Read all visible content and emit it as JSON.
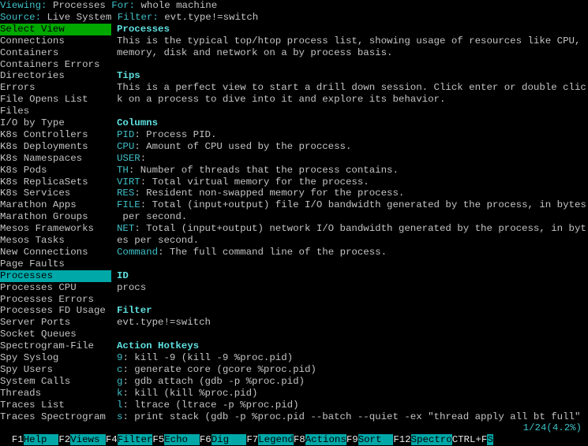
{
  "header": {
    "viewing_label": "Viewing:",
    "viewing_value": "Processes",
    "for_label": "For:",
    "for_value": "whole machine",
    "source_label": "Source:",
    "source_value": "Live System",
    "filter_label": "Filter:",
    "filter_value": "evt.type!=switch"
  },
  "views": {
    "title": "Select View",
    "items": [
      "Connections",
      "Containers",
      "Containers Errors",
      "Directories",
      "Errors",
      "File Opens List",
      "Files",
      "I/O by Type",
      "K8s Controllers",
      "K8s Deployments",
      "K8s Namespaces",
      "K8s Pods",
      "K8s ReplicaSets",
      "K8s Services",
      "Marathon Apps",
      "Marathon Groups",
      "Mesos Frameworks",
      "Mesos Tasks",
      "New Connections",
      "Page Faults",
      "Processes",
      "Processes CPU",
      "Processes Errors",
      "Processes FD Usage",
      "Server Ports",
      "Socket Queues",
      "Spectrogram-File",
      "Spy Syslog",
      "Spy Users",
      "System Calls",
      "Threads",
      "Traces List",
      "Traces Spectrogram"
    ],
    "selected": "Processes"
  },
  "info": [
    {
      "heading": "Processes"
    },
    {
      "text": "This is the typical top/htop process list, showing usage of resources like CPU,"
    },
    {
      "text": "memory, disk and network on a by process basis."
    },
    {
      "text": ""
    },
    {
      "heading": "Tips"
    },
    {
      "text": "This is a perfect view to start a drill down session. Click enter or double clic"
    },
    {
      "text": "k on a process to dive into it and explore its behavior."
    },
    {
      "text": ""
    },
    {
      "heading": "Columns"
    },
    {
      "key": "PID",
      "text": ": Process PID."
    },
    {
      "key": "CPU",
      "text": ": Amount of CPU used by the proccess."
    },
    {
      "key": "USER",
      "text": ":"
    },
    {
      "key": "TH",
      "text": ": Number of threads that the process contains."
    },
    {
      "key": "VIRT",
      "text": ": Total virtual memory for the process."
    },
    {
      "key": "RES",
      "text": ": Resident non-swapped memory for the process."
    },
    {
      "key": "FILE",
      "text": ": Total (input+output) file I/O bandwidth generated by the process, in bytes"
    },
    {
      "text": " per second."
    },
    {
      "key": "NET",
      "text": ": Total (input+output) network I/O bandwidth generated by the process, in byt"
    },
    {
      "text": "es per second."
    },
    {
      "key": "Command",
      "text": ": The full command line of the process."
    },
    {
      "text": ""
    },
    {
      "heading": "ID"
    },
    {
      "text": "procs"
    },
    {
      "text": ""
    },
    {
      "heading": "Filter"
    },
    {
      "text": "evt.type!=switch"
    },
    {
      "text": ""
    },
    {
      "heading": "Action Hotkeys"
    },
    {
      "key": "9",
      "text": ": kill -9 (kill -9 %proc.pid)"
    },
    {
      "key": "c",
      "text": ": generate core (gcore %proc.pid)"
    },
    {
      "key": "g",
      "text": ": gdb attach (gdb -p %proc.pid)"
    },
    {
      "key": "k",
      "text": ": kill (kill %proc.pid)"
    },
    {
      "key": "l",
      "text": ": ltrace (ltrace -p %proc.pid)"
    },
    {
      "key": "s",
      "text": ": print stack (gdb -p %proc.pid --batch --quiet -ex \"thread apply all bt full\""
    }
  ],
  "footer": {
    "keys": [
      {
        "key": "F1",
        "label": "Help  "
      },
      {
        "key": "F2",
        "label": "Views "
      },
      {
        "key": "F4",
        "label": "Filter"
      },
      {
        "key": "F5",
        "label": "Echo  "
      },
      {
        "key": "F6",
        "label": "Dig   "
      },
      {
        "key": "F7",
        "label": "Legend"
      },
      {
        "key": "F8",
        "label": "Actions"
      },
      {
        "key": "F9",
        "label": "Sort  "
      },
      {
        "key": "F12",
        "label": "Spectro"
      },
      {
        "key": "CTRL+F",
        "label": "S"
      }
    ],
    "position": "1/24(4.2%)"
  },
  "colors": {
    "green_highlight": "#00a800",
    "cyan_highlight": "#00a8a8",
    "label_cyan": "#3fc0c8",
    "text": "#c4c4c4"
  }
}
